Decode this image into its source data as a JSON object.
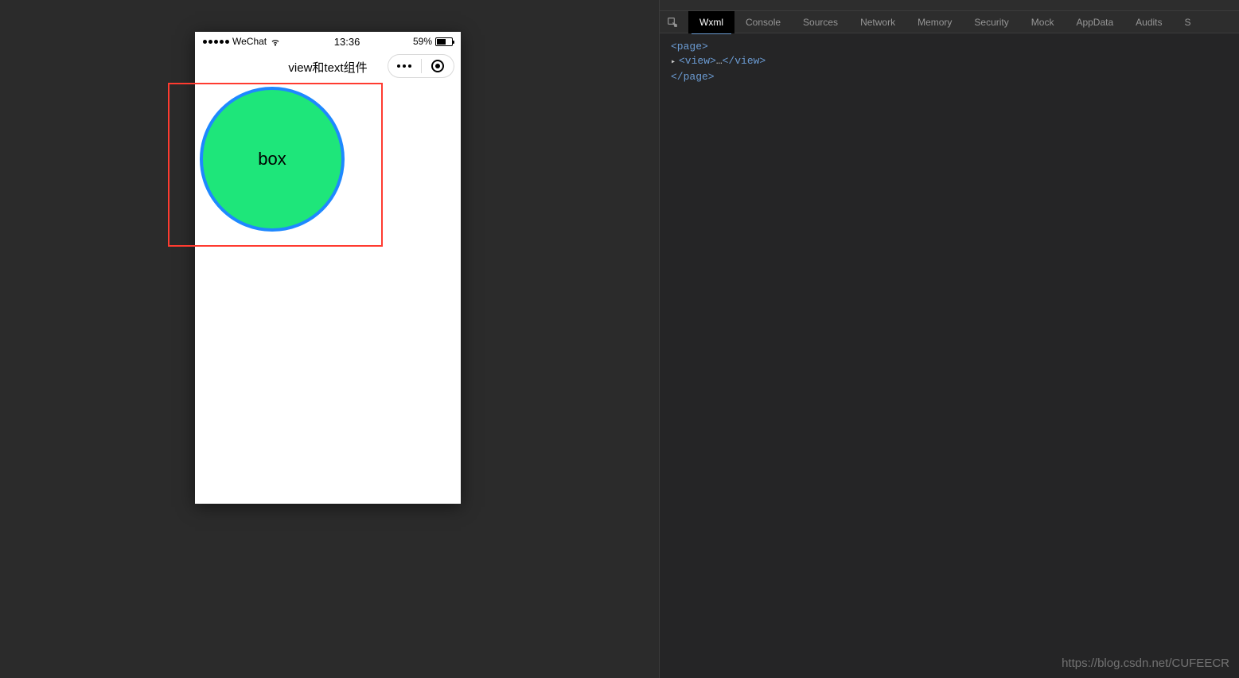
{
  "statusBar": {
    "carrier": "WeChat",
    "time": "13:36",
    "batteryPercent": "59%"
  },
  "navBar": {
    "title": "view和text组件"
  },
  "content": {
    "boxLabel": "box"
  },
  "devtools": {
    "tabs": [
      "Wxml",
      "Console",
      "Sources",
      "Network",
      "Memory",
      "Security",
      "Mock",
      "AppData",
      "Audits",
      "S"
    ],
    "activeTab": "Wxml",
    "code": {
      "line1_open": "<page>",
      "line2_prefix": "▸ ",
      "line2_open": "<view>",
      "line2_ellipsis": "…",
      "line2_close": "</view>",
      "line3_close": "</page>"
    }
  },
  "watermark": "https://blog.csdn.net/CUFEECR"
}
